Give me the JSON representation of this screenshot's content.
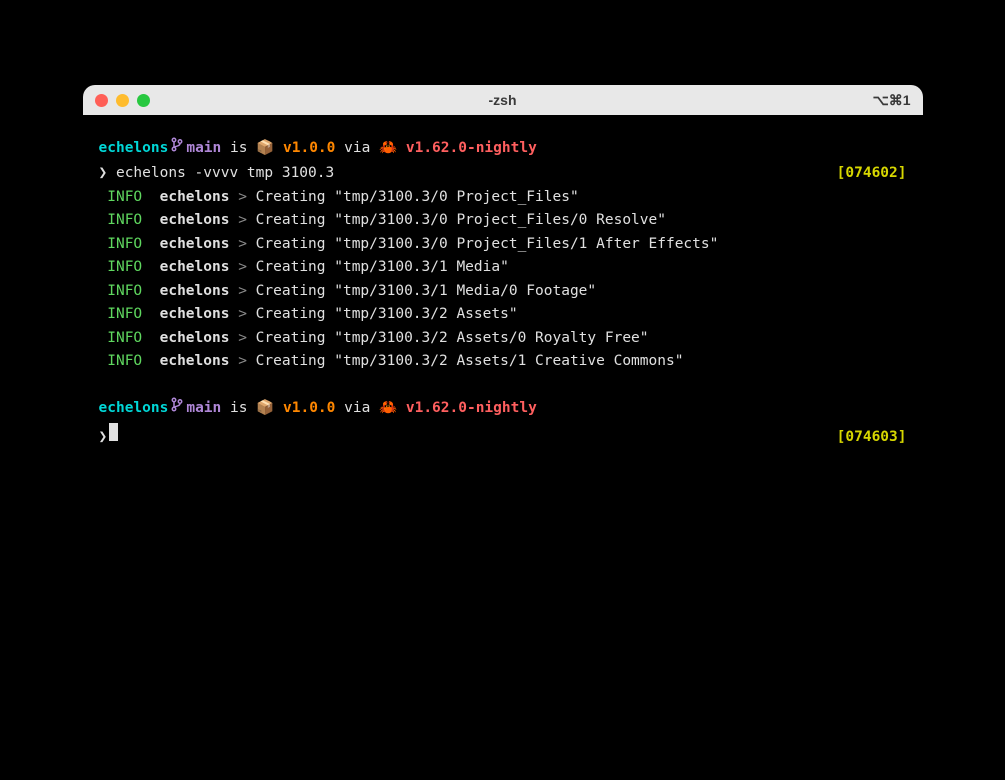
{
  "window": {
    "title": "-zsh",
    "shortcut": "⌥⌘1"
  },
  "prompt1": {
    "dir": "echelons",
    "branch": "main",
    "is_word": "is",
    "package_emoji": "📦",
    "version": "v1.0.0",
    "via_word": "via",
    "crab_emoji": "🦀",
    "rust_version": "v1.62.0-nightly",
    "arrow": "❯",
    "command": "echelons -vvvv tmp 3100.3",
    "timestamp": "[074602]"
  },
  "logs": [
    {
      "level": "INFO",
      "module": "echelons",
      "sep": ">",
      "action": "Creating",
      "path": "\"tmp/3100.3/0 Project_Files\""
    },
    {
      "level": "INFO",
      "module": "echelons",
      "sep": ">",
      "action": "Creating",
      "path": "\"tmp/3100.3/0 Project_Files/0 Resolve\""
    },
    {
      "level": "INFO",
      "module": "echelons",
      "sep": ">",
      "action": "Creating",
      "path": "\"tmp/3100.3/0 Project_Files/1 After Effects\""
    },
    {
      "level": "INFO",
      "module": "echelons",
      "sep": ">",
      "action": "Creating",
      "path": "\"tmp/3100.3/1 Media\""
    },
    {
      "level": "INFO",
      "module": "echelons",
      "sep": ">",
      "action": "Creating",
      "path": "\"tmp/3100.3/1 Media/0 Footage\""
    },
    {
      "level": "INFO",
      "module": "echelons",
      "sep": ">",
      "action": "Creating",
      "path": "\"tmp/3100.3/2 Assets\""
    },
    {
      "level": "INFO",
      "module": "echelons",
      "sep": ">",
      "action": "Creating",
      "path": "\"tmp/3100.3/2 Assets/0 Royalty Free\""
    },
    {
      "level": "INFO",
      "module": "echelons",
      "sep": ">",
      "action": "Creating",
      "path": "\"tmp/3100.3/2 Assets/1 Creative Commons\""
    }
  ],
  "prompt2": {
    "dir": "echelons",
    "branch": "main",
    "is_word": "is",
    "package_emoji": "📦",
    "version": "v1.0.0",
    "via_word": "via",
    "crab_emoji": "🦀",
    "rust_version": "v1.62.0-nightly",
    "arrow": "❯",
    "timestamp": "[074603]"
  }
}
